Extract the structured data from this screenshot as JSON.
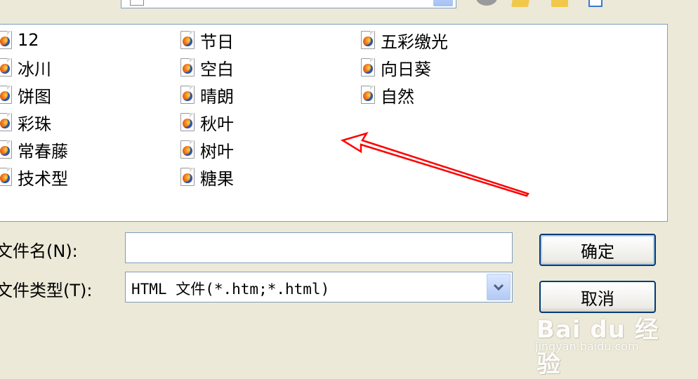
{
  "files": {
    "col1": [
      "12",
      "冰川",
      "饼图",
      "彩珠",
      "常春藤",
      "技术型"
    ],
    "col2": [
      "节日",
      "空白",
      "晴朗",
      "秋叶",
      "树叶",
      "糖果"
    ],
    "col3": [
      "五彩缴光",
      "向日葵",
      "自然"
    ]
  },
  "filename": {
    "label": "文件名(N):",
    "value": ""
  },
  "filetype": {
    "label": "文件类型(T):",
    "value": "HTML 文件(*.htm;*.html)"
  },
  "buttons": {
    "ok": "确定",
    "cancel": "取消"
  },
  "watermark": {
    "main": "Bai du 经验",
    "sub": "jingyan.baidu.com"
  },
  "colors": {
    "background": "#ece9d8",
    "border": "#7f9db9",
    "arrow": "#ff0000",
    "button_border": "#003c74"
  }
}
